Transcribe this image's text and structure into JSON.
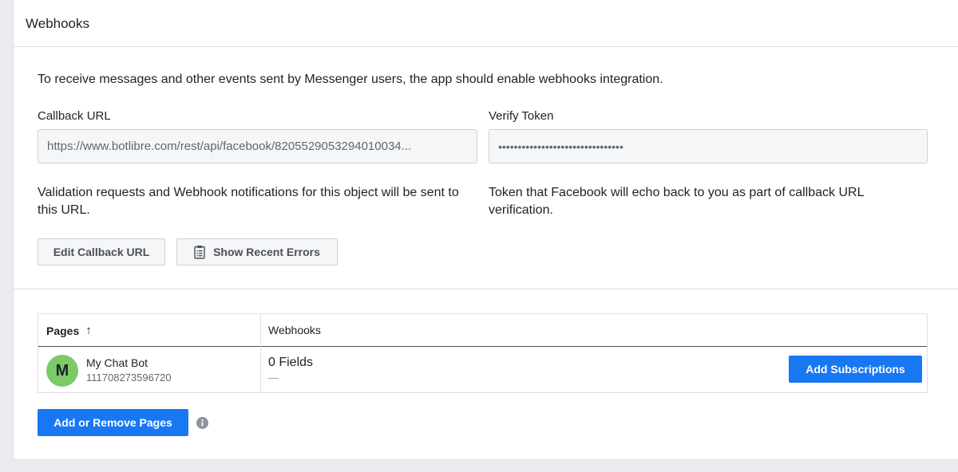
{
  "panel": {
    "title": "Webhooks"
  },
  "intro": "To receive messages and other events sent by Messenger users, the app should enable webhooks integration.",
  "callback": {
    "label": "Callback URL",
    "value": "https://www.botlibre.com/rest/api/facebook/8205529053294010034...",
    "help": "Validation requests and Webhook notifications for this object will be sent to this URL."
  },
  "verify": {
    "label": "Verify Token",
    "value": "••••••••••••••••••••••••••••••••",
    "help": "Token that Facebook will echo back to you as part of callback URL verification."
  },
  "actions": {
    "edit_callback_label": "Edit Callback URL",
    "show_errors_label": "Show Recent Errors",
    "show_errors_icon": "clipboard-icon"
  },
  "table": {
    "columns": {
      "pages": "Pages",
      "pages_sort_icon": "arrow-up-icon",
      "webhooks": "Webhooks"
    },
    "rows": [
      {
        "avatar_letter": "M",
        "avatar_color": "#7bc967",
        "name": "My Chat Bot",
        "id": "111708273596720",
        "fields": "0 Fields",
        "fields_detail": "—",
        "action_label": "Add Subscriptions"
      }
    ]
  },
  "footer": {
    "add_remove_label": "Add or Remove Pages",
    "info_icon": "info-icon"
  },
  "colors": {
    "accent": "#1877f2",
    "page_bg": "#e9ebee",
    "border": "#dddfe2"
  }
}
